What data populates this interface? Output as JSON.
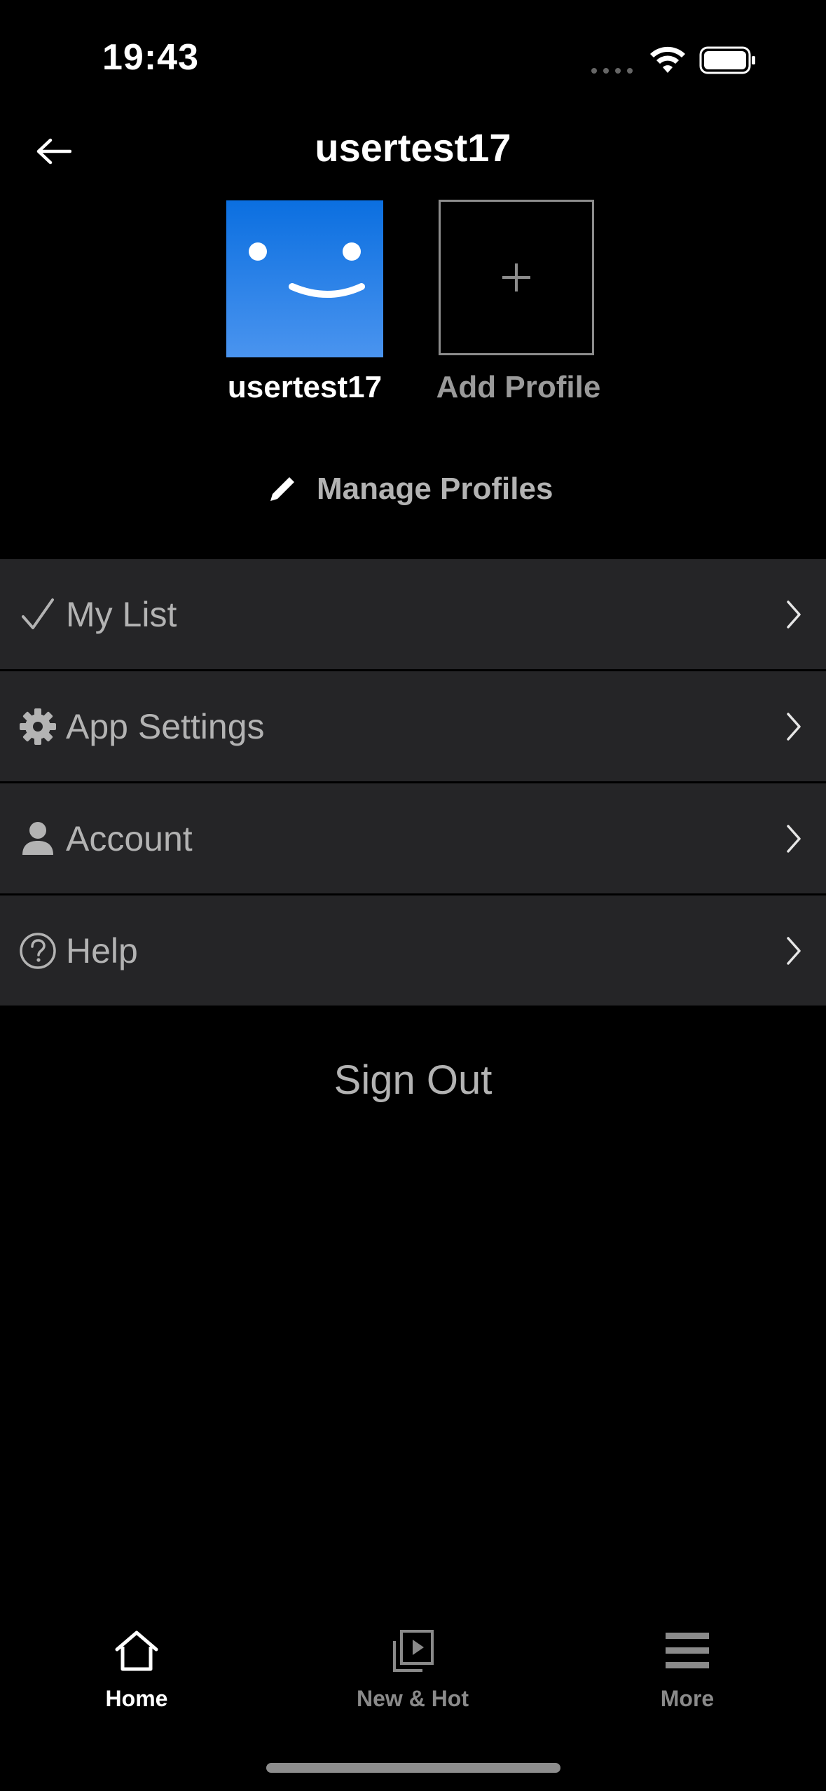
{
  "status_bar": {
    "time": "19:43",
    "wifi_icon": "wifi-icon",
    "battery_icon": "battery-icon"
  },
  "header": {
    "title": "usertest17",
    "back_icon": "arrow-left-icon"
  },
  "profiles": {
    "current": {
      "name": "usertest17",
      "avatar_color": "#1a73e8"
    },
    "add": {
      "label": "Add Profile",
      "icon": "plus-icon"
    }
  },
  "manage": {
    "label": "Manage Profiles",
    "icon": "pencil-icon"
  },
  "menu": {
    "items": [
      {
        "label": "My List",
        "icon": "checkmark-icon"
      },
      {
        "label": "App Settings",
        "icon": "gear-icon"
      },
      {
        "label": "Account",
        "icon": "person-icon"
      },
      {
        "label": "Help",
        "icon": "question-circle-icon"
      }
    ]
  },
  "sign_out": {
    "label": "Sign Out"
  },
  "tab_bar": {
    "tabs": [
      {
        "label": "Home",
        "icon": "home-icon",
        "active": true
      },
      {
        "label": "New & Hot",
        "icon": "play-stack-icon",
        "active": false
      },
      {
        "label": "More",
        "icon": "hamburger-icon",
        "active": false
      }
    ]
  },
  "colors": {
    "background": "#000000",
    "menu_row": "#252527",
    "muted_text": "#b3b3b3",
    "avatar_blue": "#1a73e8"
  }
}
